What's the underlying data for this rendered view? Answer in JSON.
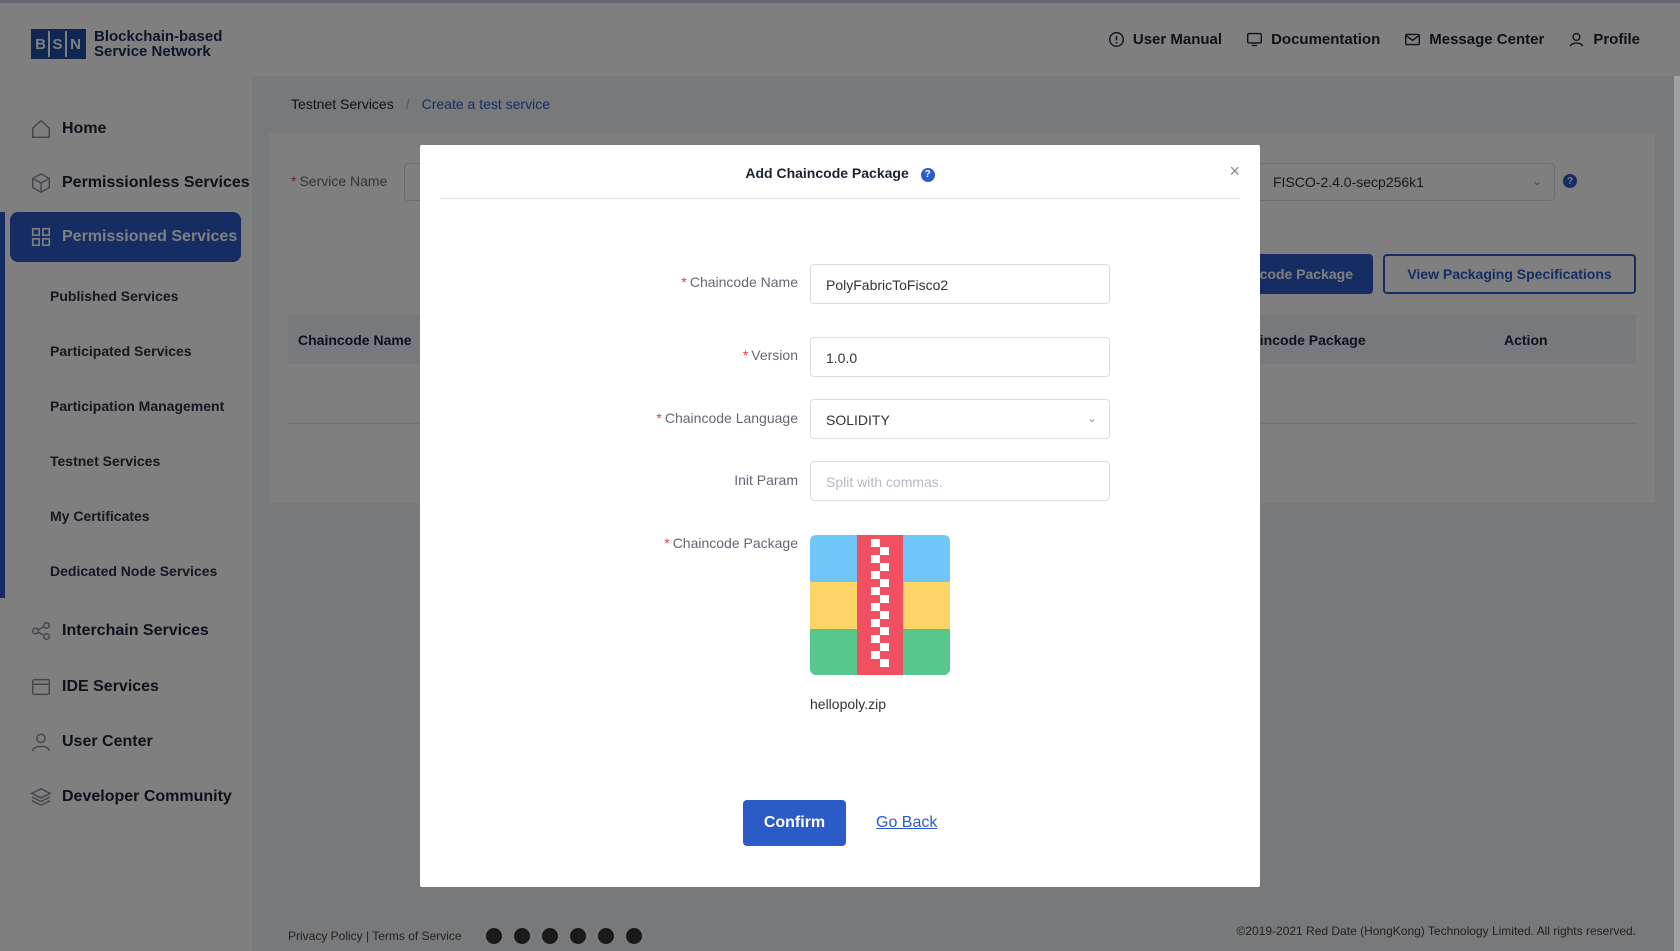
{
  "header": {
    "logo_letters": [
      "B",
      "S",
      "N"
    ],
    "logo_line1": "Blockchain-based",
    "logo_line2": "Service Network",
    "links": {
      "user_manual": "User Manual",
      "documentation": "Documentation",
      "message_center": "Message Center",
      "profile": "Profile"
    }
  },
  "sidebar": {
    "home": "Home",
    "permissionless": "Permissionless Services",
    "permissioned": "Permissioned Services",
    "sub": {
      "published": "Published Services",
      "participated": "Participated Services",
      "participation_mgmt": "Participation Management",
      "testnet": "Testnet Services",
      "certificates": "My Certificates",
      "dedicated": "Dedicated Node Services"
    },
    "interchain": "Interchain Services",
    "ide": "IDE Services",
    "user_center": "User Center",
    "developer_community": "Developer Community"
  },
  "breadcrumb": {
    "first": "Testnet Services",
    "separator": "/",
    "current": "Create a test service"
  },
  "background_form": {
    "service_name_label": "Service Name",
    "framework_value": "FISCO-2.4.0-secp256k1",
    "add_package_button": "code Package",
    "view_spec_button": "View Packaging Specifications",
    "table_headers": {
      "chaincode_name": "Chaincode Name",
      "chaincode_package": "aincode Package",
      "action": "Action"
    }
  },
  "footer": {
    "links": "Privacy Policy | Terms of Service",
    "copyright": "©2019-2021 Red Date (HongKong) Technology Limited. All rights reserved."
  },
  "modal": {
    "title": "Add Chaincode Package",
    "help": "?",
    "close": "×",
    "fields": {
      "chaincode_name": {
        "label": "Chaincode Name",
        "value": "PolyFabricToFisco2"
      },
      "version": {
        "label": "Version",
        "value": "1.0.0"
      },
      "language": {
        "label": "Chaincode Language",
        "value": "SOLIDITY"
      },
      "init_param": {
        "label": "Init Param",
        "placeholder": "Split with commas."
      },
      "package": {
        "label": "Chaincode Package",
        "file_name": "hellopoly.zip"
      }
    },
    "confirm_button": "Confirm",
    "go_back_link": "Go Back"
  },
  "colors": {
    "primary": "#2b5bc7",
    "required": "#e4393c",
    "zip_blue": "#6ec6f9",
    "zip_yellow": "#fdd566",
    "zip_green": "#58c78e",
    "zip_red": "#f0505f"
  }
}
